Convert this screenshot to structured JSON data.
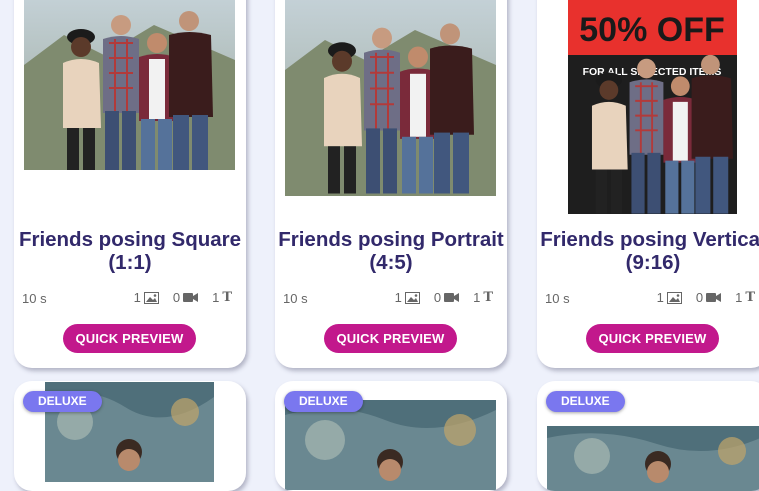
{
  "cards": [
    {
      "title_line1": "Friends posing Square",
      "title_line2": "(1:1)",
      "duration": "10 s",
      "images": "1",
      "videos": "0",
      "texts": "1",
      "preview_label": "QUICK PREVIEW",
      "thumb_icon": "group-photo"
    },
    {
      "title_line1": "Friends posing Portrait",
      "title_line2": "(4:5)",
      "duration": "10 s",
      "images": "1",
      "videos": "0",
      "texts": "1",
      "preview_label": "QUICK PREVIEW",
      "thumb_icon": "group-photo"
    },
    {
      "title_line1": "Friends posing Vertical",
      "title_line2": "(9:16)",
      "duration": "10 s",
      "images": "1",
      "videos": "0",
      "texts": "1",
      "preview_label": "QUICK PREVIEW",
      "thumb_icon": "group-photo-sale-banner",
      "banner_big": "50% OFF",
      "banner_small": "FOR ALL SELECTED ITEMS"
    }
  ],
  "deluxe_cards": [
    {
      "badge": "DELUXE"
    },
    {
      "badge": "DELUXE"
    },
    {
      "badge": "DELUXE"
    }
  ],
  "icons": {
    "image": "image-icon",
    "video": "video-camera-icon",
    "text": "text-icon"
  },
  "colors": {
    "page_bg": "#eef1fb",
    "title": "#32296b",
    "preview_button": "#c2188c",
    "badge": "#7a77ef"
  }
}
